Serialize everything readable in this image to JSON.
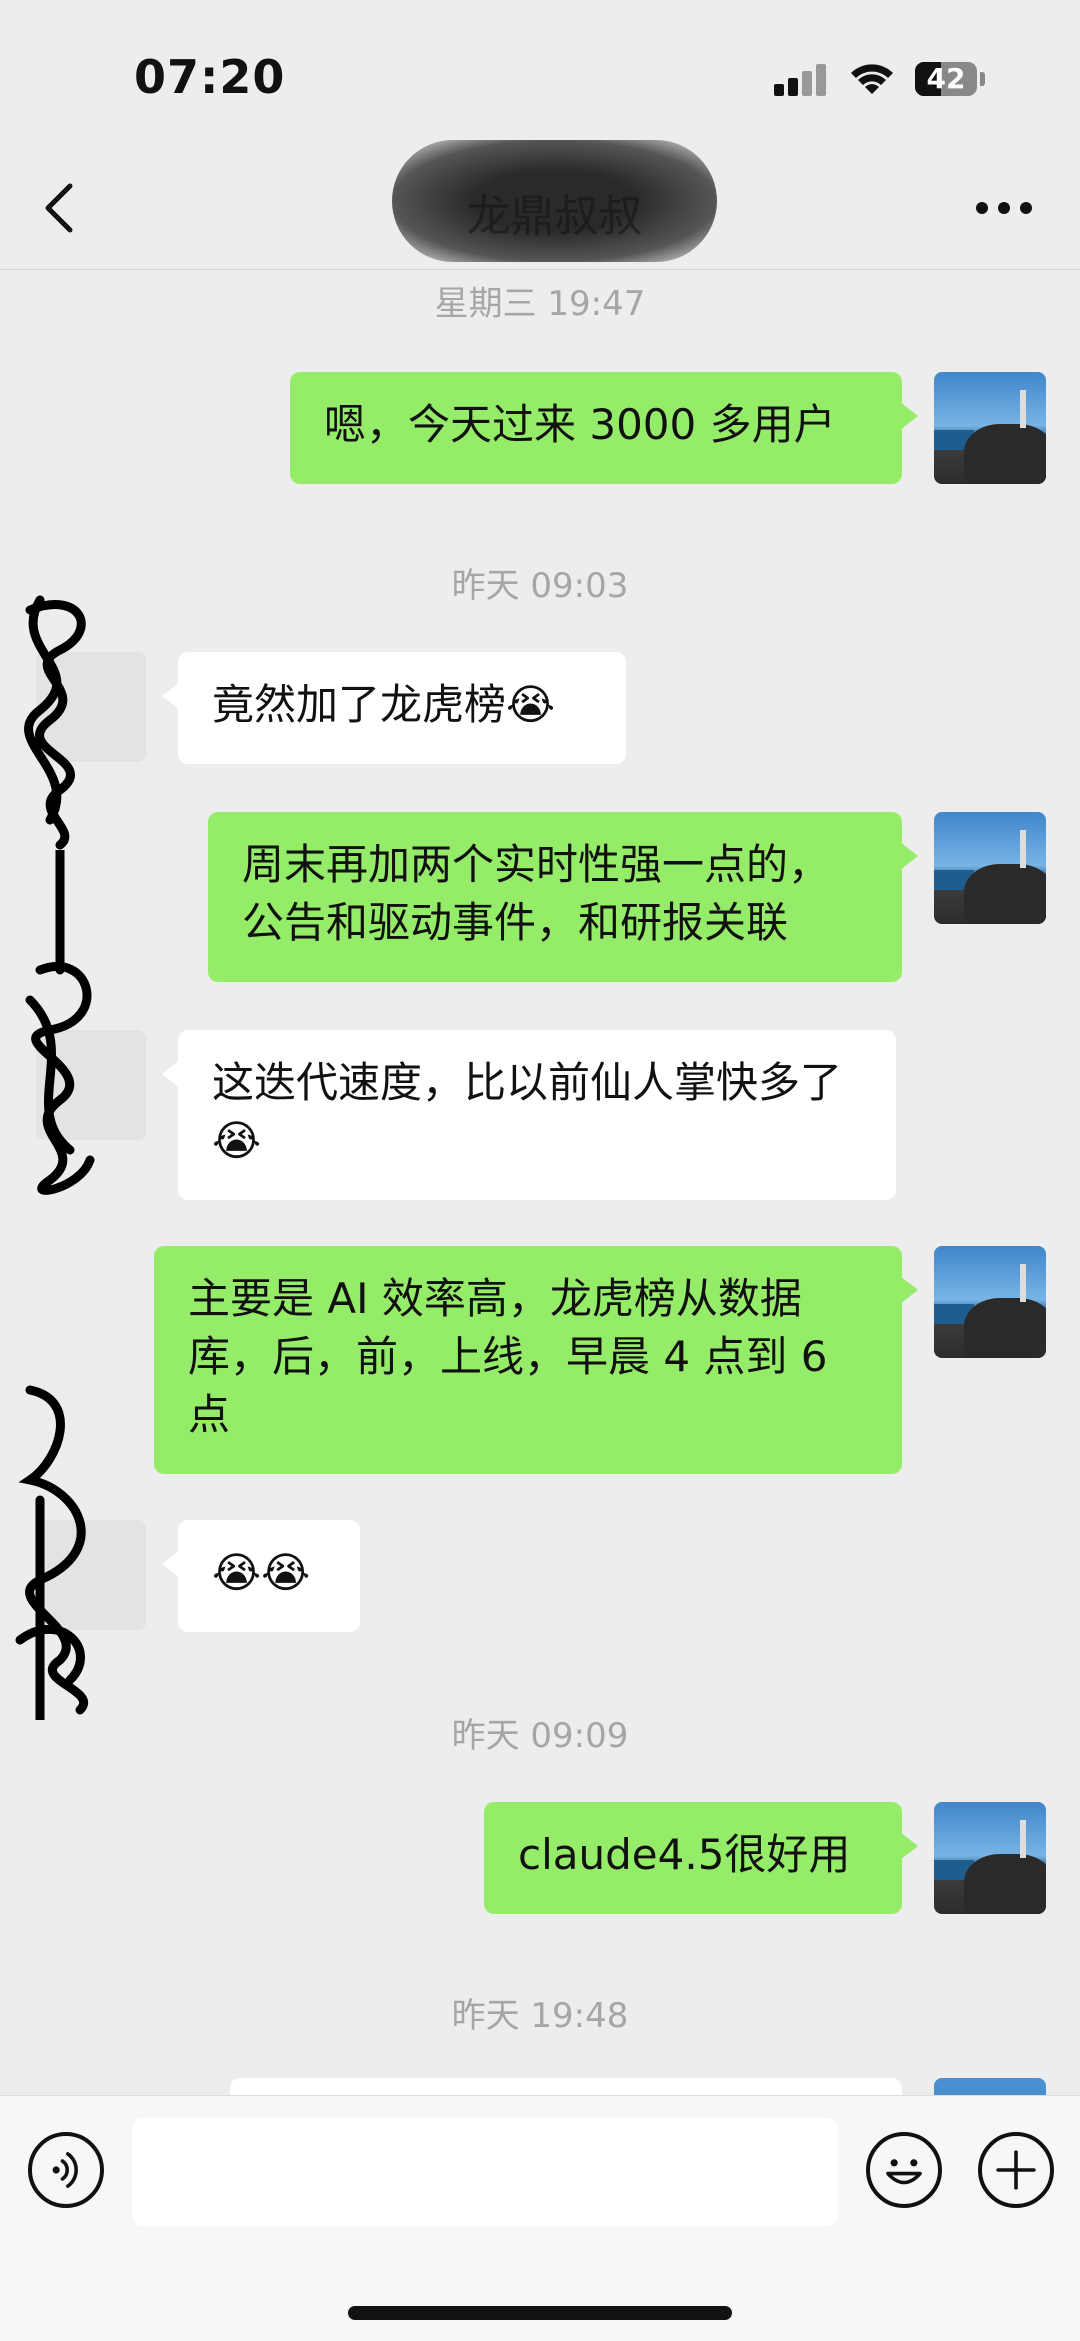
{
  "status_bar": {
    "time": "07:20",
    "battery": "42"
  },
  "header": {
    "title": "龙鼎叔叔"
  },
  "messages": [
    {
      "type": "time",
      "text": "星期三 19:47"
    },
    {
      "type": "me",
      "text": "嗯，今天过来 3000 多用户"
    },
    {
      "type": "time",
      "text": "昨天 09:03"
    },
    {
      "type": "other",
      "text": "竟然加了龙虎榜😭"
    },
    {
      "type": "me",
      "text": "周末再加两个实时性强一点的，公告和驱动事件，和研报关联"
    },
    {
      "type": "other",
      "text": "这迭代速度，比以前仙人掌快多了😭"
    },
    {
      "type": "me",
      "text": "主要是 AI 效率高，龙虎榜从数据库，后，前，上线，早晨 4 点到 6 点"
    },
    {
      "type": "other",
      "text": "😭😭"
    },
    {
      "type": "time",
      "text": "昨天 09:09"
    },
    {
      "type": "me",
      "text": "claude4.5很好用"
    },
    {
      "type": "time",
      "text": "昨天 19:48"
    }
  ],
  "input": {
    "placeholder": ""
  },
  "colors": {
    "bubble_me": "#95EC69",
    "bubble_other": "#FFFFFF",
    "background": "#EDEDED",
    "timestamp": "#A6A6A6"
  },
  "icons": [
    "chevron-left-icon",
    "more-icon",
    "voice-icon",
    "emoji-icon",
    "plus-icon",
    "signal-icon",
    "wifi-icon",
    "battery-icon"
  ]
}
